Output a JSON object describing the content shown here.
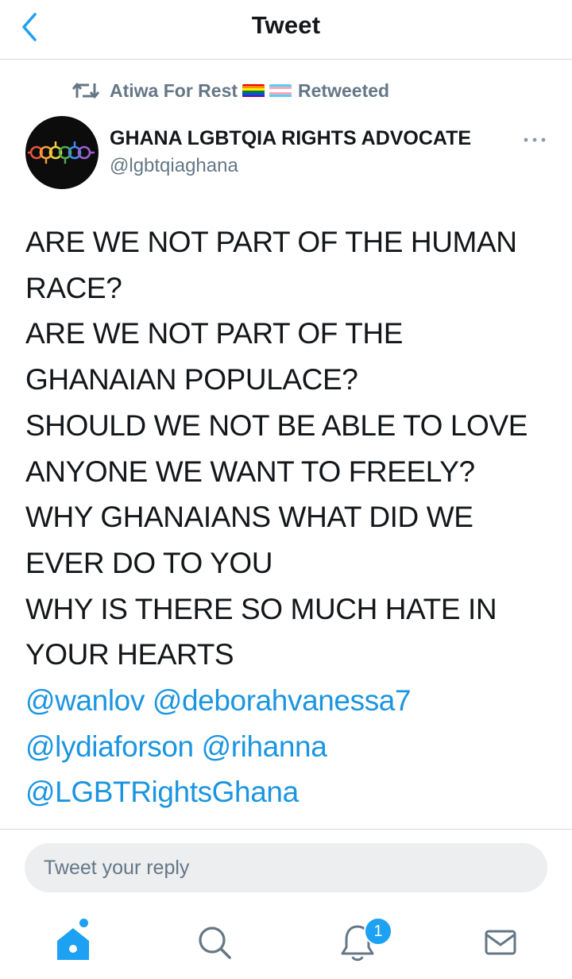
{
  "header": {
    "title": "Tweet",
    "back_icon": "chevron-left-icon"
  },
  "retweet": {
    "user": "Atiwa For Rest",
    "label": "Retweeted",
    "icon": "retweet-icon",
    "flags": [
      "rainbow-flag",
      "transgender-flag"
    ]
  },
  "author": {
    "name": "GHANA LGBTQIA RIGHTS ADVOCATE",
    "handle": "@lgbtqiaghana",
    "avatar": "avatar-linked-gender-symbols"
  },
  "more_icon": "more-horizontal-icon",
  "tweet": {
    "lines": [
      "ARE WE NOT PART OF THE HUMAN",
      "RACE?",
      "ARE WE NOT PART OF THE",
      "GHANAIAN POPULACE?",
      "SHOULD WE NOT BE ABLE TO LOVE",
      "ANYONE WE WANT TO FREELY?",
      "WHY GHANAIANS WHAT DID WE",
      "EVER DO TO YOU",
      "WHY IS THERE SO MUCH HATE IN",
      "YOUR HEARTS"
    ],
    "mentions": [
      "@wanlov",
      "@deborahvanessa7",
      "@lydiaforson",
      "@rihanna",
      "@LGBTRightsGhana"
    ]
  },
  "reply": {
    "placeholder": "Tweet your reply"
  },
  "tabbar": {
    "tabs": [
      {
        "name": "home",
        "icon": "home-icon",
        "active": true
      },
      {
        "name": "search",
        "icon": "search-icon",
        "active": false
      },
      {
        "name": "notifications",
        "icon": "bell-icon",
        "active": false
      },
      {
        "name": "messages",
        "icon": "mail-icon",
        "active": false
      }
    ],
    "notifications_badge": "1"
  },
  "colors": {
    "accent": "#1da1f2",
    "link": "#1b95e0",
    "muted": "#657786",
    "text": "#14171a"
  }
}
